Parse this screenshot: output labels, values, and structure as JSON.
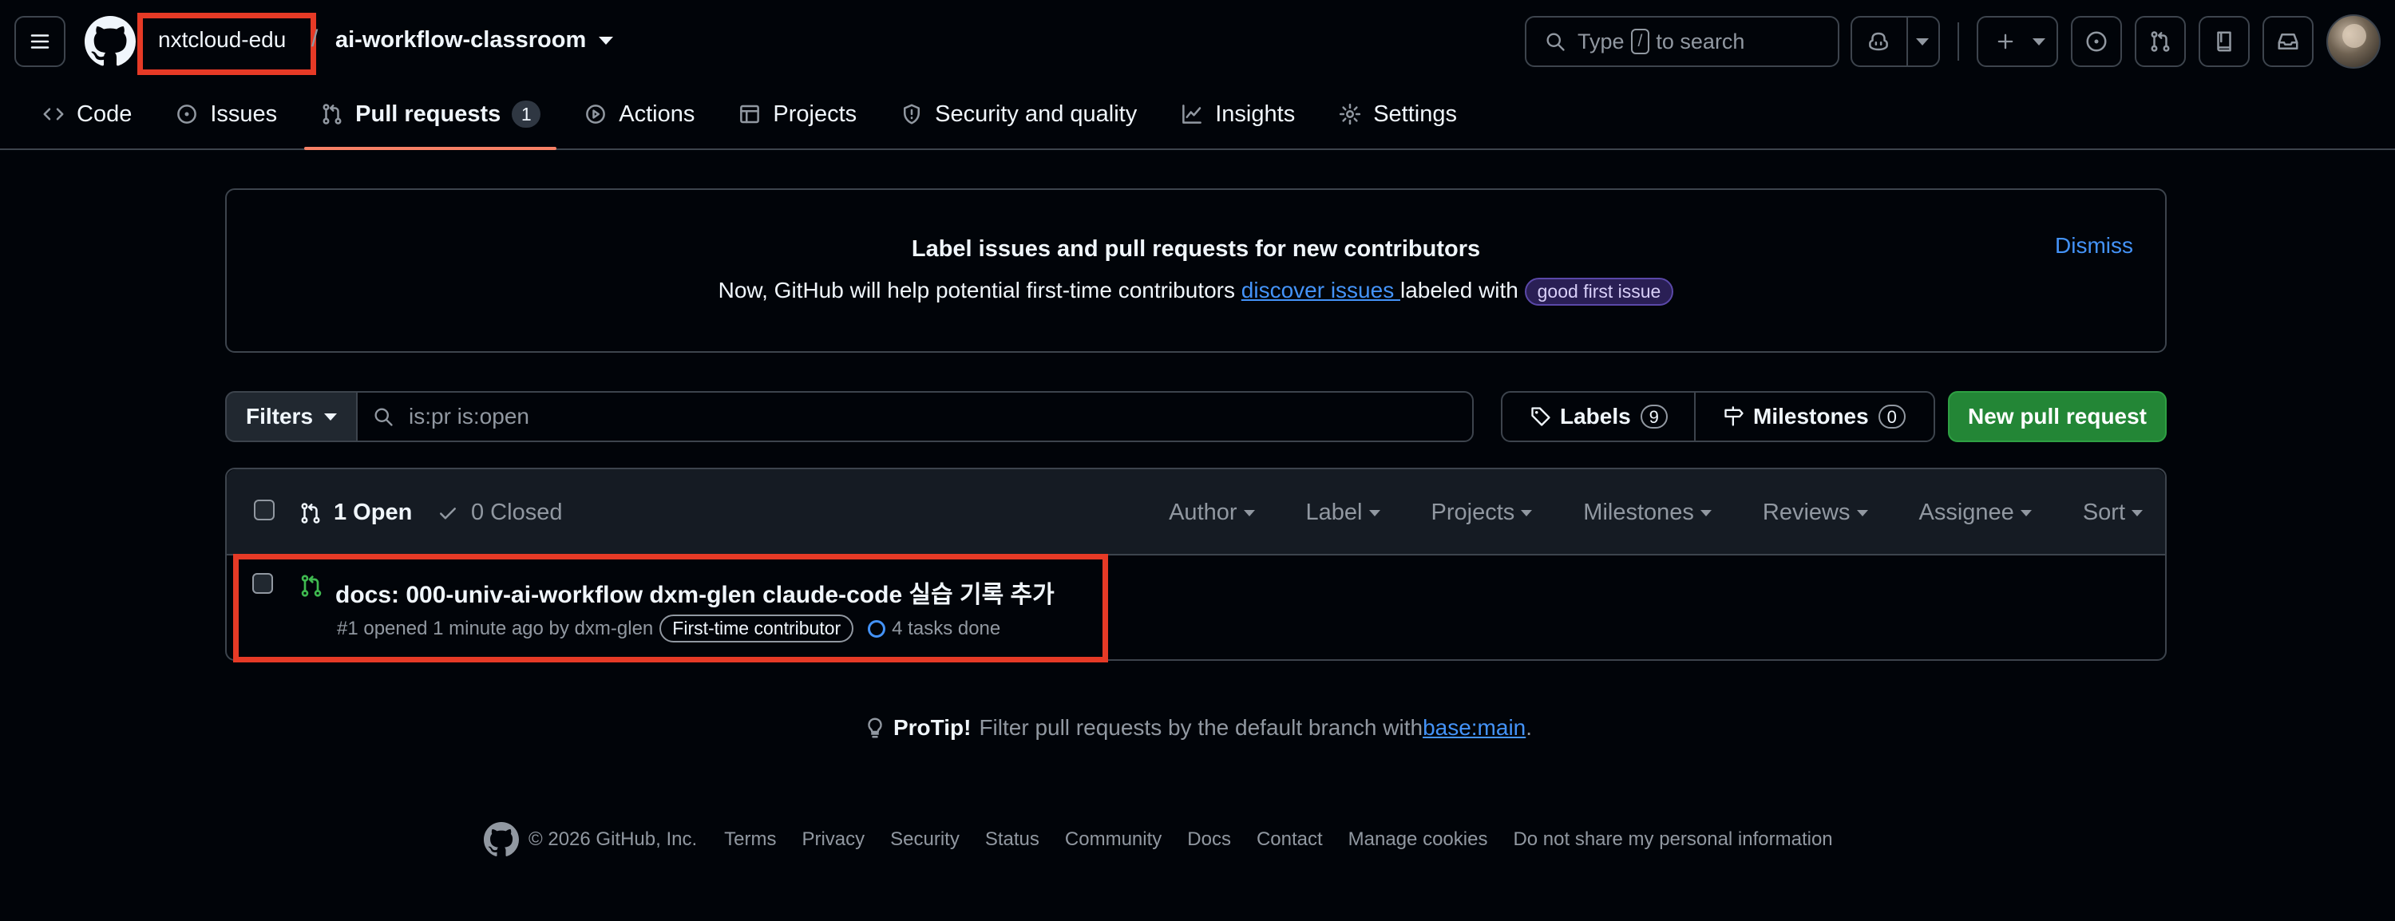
{
  "header": {
    "owner": "nxtcloud-edu",
    "separator": "/",
    "repo": "ai-workflow-classroom",
    "search": {
      "prefix": "Type",
      "key": "/",
      "suffix": "to search"
    }
  },
  "tabs": [
    {
      "label": "Code",
      "icon": "code-icon"
    },
    {
      "label": "Issues",
      "icon": "issue-opened-icon"
    },
    {
      "label": "Pull requests",
      "icon": "git-pull-request-icon",
      "count": "1",
      "active": true
    },
    {
      "label": "Actions",
      "icon": "play-icon"
    },
    {
      "label": "Projects",
      "icon": "table-icon"
    },
    {
      "label": "Security and quality",
      "icon": "shield-icon"
    },
    {
      "label": "Insights",
      "icon": "graph-icon"
    },
    {
      "label": "Settings",
      "icon": "gear-icon"
    }
  ],
  "banner": {
    "title": "Label issues and pull requests for new contributors",
    "text_before": "Now, GitHub will help potential first-time contributors ",
    "link": "discover issues ",
    "text_after": " labeled with ",
    "label": "good first issue",
    "dismiss": "Dismiss"
  },
  "filterbar": {
    "filters_label": "Filters",
    "query": "is:pr is:open",
    "labels_label": "Labels",
    "labels_count": "9",
    "milestones_label": "Milestones",
    "milestones_count": "0",
    "new_pr_label": "New pull request"
  },
  "list": {
    "open_label": "1 Open",
    "closed_label": "0 Closed",
    "sort_options": [
      "Author",
      "Label",
      "Projects",
      "Milestones",
      "Reviews",
      "Assignee",
      "Sort"
    ],
    "items": [
      {
        "title": "docs: 000-univ-ai-workflow dxm-glen claude-code 실습 기록 추가",
        "meta": "#1 opened 1 minute ago by dxm-glen",
        "badge": "First-time contributor",
        "tasks": "4 tasks done"
      }
    ]
  },
  "protip": {
    "label": "ProTip!",
    "text": "Filter pull requests by the default branch with ",
    "link": "base:main",
    "end": "."
  },
  "footer": {
    "copyright": "© 2026 GitHub, Inc.",
    "links": [
      "Terms",
      "Privacy",
      "Security",
      "Status",
      "Community",
      "Docs",
      "Contact",
      "Manage cookies",
      "Do not share my personal information"
    ]
  },
  "colors": {
    "background": "#010409",
    "accent_link": "#4493f8",
    "open_green": "#3fb950",
    "primary_button": "#238636",
    "active_tab_underline": "#f78166",
    "highlight_box": "#e63a26"
  }
}
